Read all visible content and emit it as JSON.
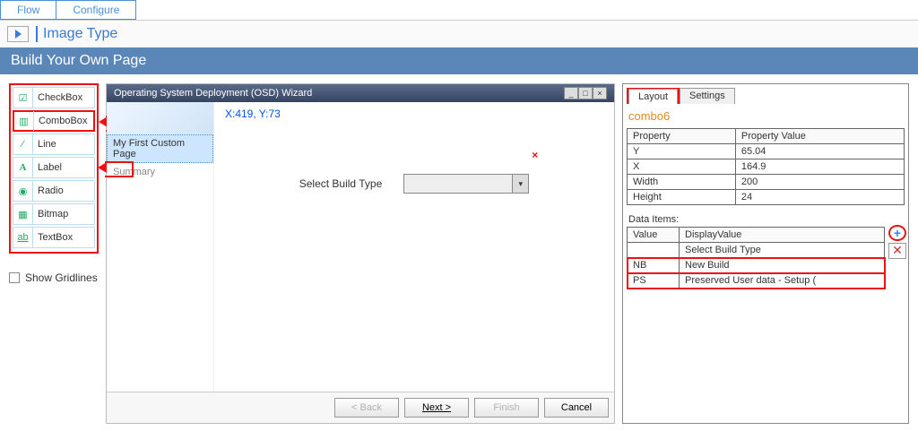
{
  "topbar": {
    "tabs": [
      "Flow",
      "Configure"
    ]
  },
  "breadcrumb": {
    "item": "Image Type"
  },
  "page_title": "Build Your Own Page",
  "toolbox": {
    "items": [
      {
        "icon": "checkbox-icon",
        "label": "CheckBox"
      },
      {
        "icon": "combobox-icon",
        "label": "ComboBox"
      },
      {
        "icon": "line-icon",
        "label": "Line"
      },
      {
        "icon": "label-icon",
        "label": "Label"
      },
      {
        "icon": "radio-icon",
        "label": "Radio"
      },
      {
        "icon": "bitmap-icon",
        "label": "Bitmap"
      },
      {
        "icon": "textbox-icon",
        "label": "TextBox"
      }
    ],
    "show_gridlines": "Show Gridlines"
  },
  "canvas": {
    "title": "Operating System Deployment (OSD) Wizard",
    "nav": {
      "items": [
        "My First Custom Page",
        "Summary"
      ]
    },
    "coord": "X:419, Y:73",
    "form": {
      "label": "Select Build Type"
    },
    "buttons": {
      "back": "< Back",
      "next": "Next >",
      "finish": "Finish",
      "cancel": "Cancel"
    }
  },
  "panel": {
    "tabs": [
      "Layout",
      "Settings"
    ],
    "section": "combo6",
    "props": {
      "headers": [
        "Property",
        "Property Value"
      ],
      "rows": [
        {
          "k": "Y",
          "v": "65.04"
        },
        {
          "k": "X",
          "v": "164.9"
        },
        {
          "k": "Width",
          "v": "200"
        },
        {
          "k": "Height",
          "v": "24"
        }
      ]
    },
    "data_items": {
      "label": "Data Items:",
      "headers": [
        "Value",
        "DisplayValue"
      ],
      "rows": [
        {
          "v": "",
          "d": "Select Build Type"
        },
        {
          "v": "NB",
          "d": "New Build"
        },
        {
          "v": "PS",
          "d": "Preserved User data - Setup ("
        }
      ]
    }
  }
}
